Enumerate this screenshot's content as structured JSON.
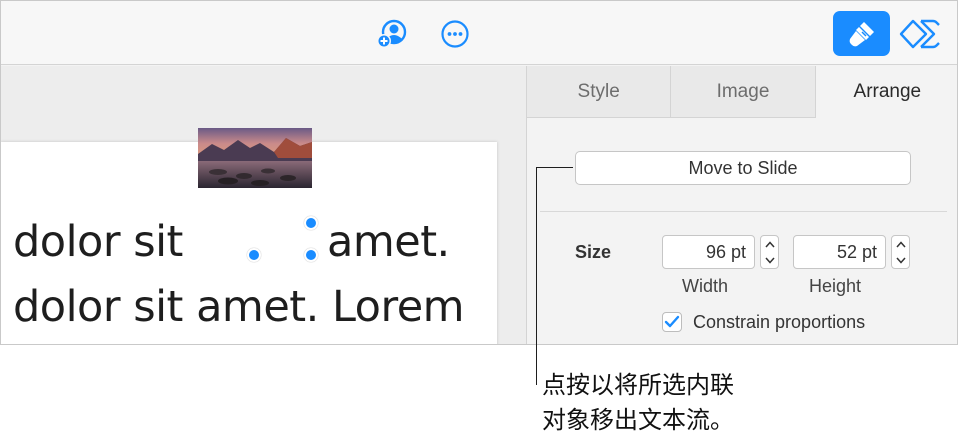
{
  "toolbar": {
    "icons": [
      "add-collaborator-icon",
      "more-icon",
      "format-brush-icon",
      "animate-icon"
    ],
    "accent_color": "#1a8cff"
  },
  "slide": {
    "line1_before": "dolor sit",
    "line1_after": "amet.",
    "line2": "dolor sit amet. Lorem"
  },
  "sidebar": {
    "tabs": [
      {
        "label": "Style"
      },
      {
        "label": "Image"
      },
      {
        "label": "Arrange"
      }
    ],
    "active_tab": "Arrange",
    "move_button_label": "Move to Slide",
    "size_label": "Size",
    "width_value": "96 pt",
    "height_value": "52 pt",
    "width_caption": "Width",
    "height_caption": "Height",
    "constrain_label": "Constrain proportions",
    "constrain_checked": true
  },
  "callout": {
    "line1": "点按以将所选内联",
    "line2": "对象移出文本流。"
  }
}
